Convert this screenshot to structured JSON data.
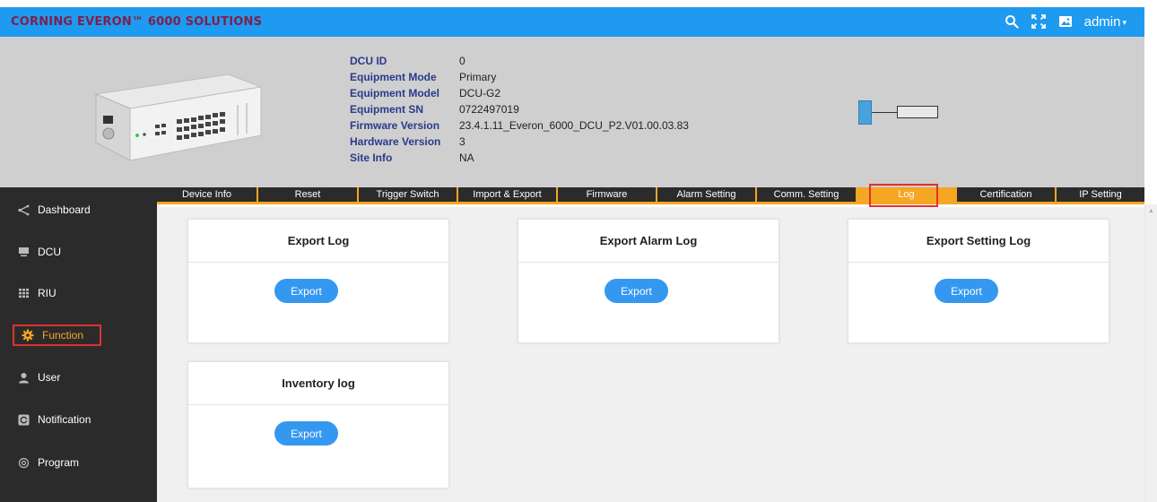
{
  "brand": {
    "title": "CORNING EVERON™ 6000 SOLUTIONS",
    "title_color": "#7f1f4c",
    "bar_color": "#1e9af0"
  },
  "header": {
    "icons": [
      "search-icon",
      "fullscreen-icon",
      "image-icon"
    ],
    "user": "admin"
  },
  "device_info": {
    "rows": [
      {
        "label": "DCU ID",
        "value": "0"
      },
      {
        "label": "Equipment Mode",
        "value": "Primary"
      },
      {
        "label": "Equipment Model",
        "value": "DCU-G2"
      },
      {
        "label": "Equipment SN",
        "value": "0722497019"
      },
      {
        "label": "Firmware Version",
        "value": "23.4.1.11_Everon_6000_DCU_P2.V01.00.03.83"
      },
      {
        "label": "Hardware Version",
        "value": "3"
      },
      {
        "label": "Site Info",
        "value": "NA"
      }
    ]
  },
  "sidebar": {
    "items": [
      {
        "label": "Dashboard",
        "icon": "share-icon"
      },
      {
        "label": "DCU",
        "icon": "monitor-icon"
      },
      {
        "label": "RIU",
        "icon": "grid-icon"
      },
      {
        "label": "Function",
        "icon": "gear-icon",
        "active": true
      },
      {
        "label": "User",
        "icon": "user-icon"
      },
      {
        "label": "Notification",
        "icon": "notification-icon"
      },
      {
        "label": "Program",
        "icon": "program-icon"
      }
    ]
  },
  "tabs": [
    {
      "label": "Device Info"
    },
    {
      "label": "Reset"
    },
    {
      "label": "Trigger Switch"
    },
    {
      "label": "Import & Export"
    },
    {
      "label": "Firmware"
    },
    {
      "label": "Alarm Setting"
    },
    {
      "label": "Comm. Setting"
    },
    {
      "label": "Log",
      "active": true
    },
    {
      "label": "Certification"
    },
    {
      "label": "IP Setting"
    }
  ],
  "cards": [
    {
      "title": "Export Log",
      "button": "Export"
    },
    {
      "title": "Export Alarm Log",
      "button": "Export"
    },
    {
      "title": "Export Setting Log",
      "button": "Export"
    },
    {
      "title": "Inventory log",
      "button": "Export"
    }
  ],
  "colors": {
    "accent": "#f5a623",
    "button": "#3598f0",
    "highlight_outline": "#e03030",
    "sidebar_bg": "#2b2b2b"
  }
}
